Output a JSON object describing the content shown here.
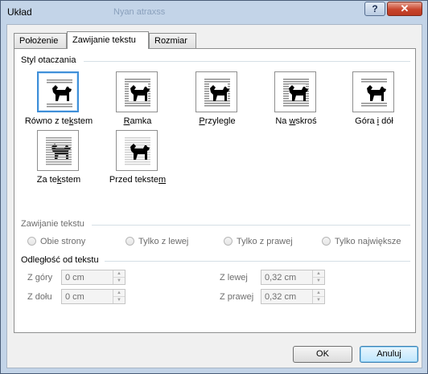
{
  "window": {
    "title": "Układ",
    "ghost_title": "Nyan atraxss",
    "help_label": "?",
    "close_label": "✕"
  },
  "tabs": [
    {
      "label": "Położenie",
      "active": false
    },
    {
      "label": "Zawijanie tekstu",
      "active": true
    },
    {
      "label": "Rozmiar",
      "active": false
    }
  ],
  "wrap_style": {
    "header": "Styl otaczania",
    "options": [
      {
        "pre": "Równo z te",
        "key": "k",
        "post": "stem",
        "selected": true,
        "icon": "wrap-in-line-icon"
      },
      {
        "pre": "",
        "key": "R",
        "post": "amka",
        "selected": false,
        "icon": "wrap-square-icon"
      },
      {
        "pre": "",
        "key": "P",
        "post": "rzylegle",
        "selected": false,
        "icon": "wrap-tight-icon"
      },
      {
        "pre": "Na ",
        "key": "w",
        "post": "skroś",
        "selected": false,
        "icon": "wrap-through-icon"
      },
      {
        "pre": "Góra ",
        "key": "i",
        "post": " dół",
        "selected": false,
        "icon": "wrap-top-bottom-icon"
      },
      {
        "pre": "Za te",
        "key": "k",
        "post": "stem",
        "selected": false,
        "icon": "wrap-behind-text-icon"
      },
      {
        "pre": "Przed tekste",
        "key": "m",
        "post": "",
        "selected": false,
        "icon": "wrap-in-front-icon"
      }
    ]
  },
  "wrap_text": {
    "header": "Zawijanie tekstu",
    "options": [
      "Obie strony",
      "Tylko z lewej",
      "Tylko z prawej",
      "Tylko największe"
    ]
  },
  "distance": {
    "header": "Odległość od tekstu",
    "top": {
      "label": "Z góry",
      "value": "0 cm"
    },
    "bottom": {
      "label": "Z dołu",
      "value": "0 cm"
    },
    "left": {
      "label": "Z lewej",
      "value": "0,32 cm"
    },
    "right": {
      "label": "Z prawej",
      "value": "0,32 cm"
    }
  },
  "buttons": {
    "ok": "OK",
    "cancel": "Anuluj"
  }
}
